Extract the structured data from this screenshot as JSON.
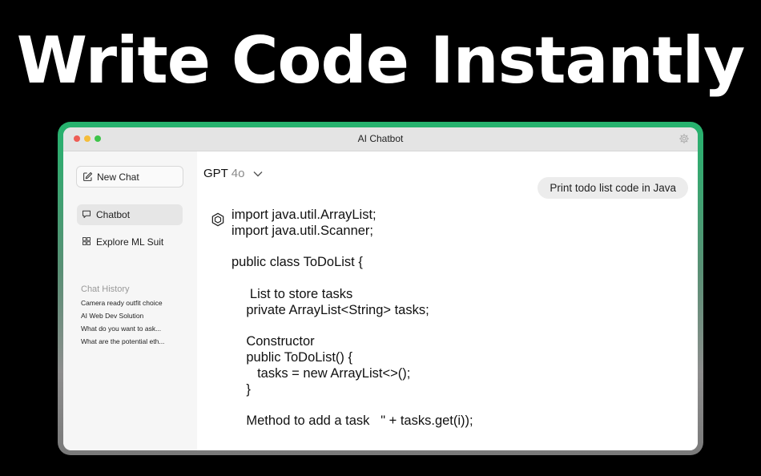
{
  "headline": "Write Code Instantly",
  "window": {
    "title": "AI Chatbot",
    "settings_icon": "gear-icon"
  },
  "sidebar": {
    "new_chat": {
      "label": "New Chat",
      "icon": "edit-icon"
    },
    "items": [
      {
        "label": "Chatbot",
        "icon": "chat-bubble-icon",
        "active": true
      },
      {
        "label": "Explore ML Suit",
        "icon": "grid-icon",
        "active": false
      }
    ],
    "history": {
      "title": "Chat History",
      "items": [
        "Camera ready outfit choice",
        "AI Web Dev Solution",
        "What do you want to ask...",
        "What are the potential eth..."
      ]
    }
  },
  "main": {
    "model": {
      "name": "GPT",
      "version": "4o"
    },
    "user_message": "Print todo list code in Java",
    "code_lines": [
      "import java.util.ArrayList;",
      "import java.util.Scanner;",
      "",
      "public class ToDoList {",
      "",
      "     List to store tasks",
      "    private ArrayList<String> tasks;",
      "",
      "    Constructor",
      "    public ToDoList() {",
      "       tasks = new ArrayList<>();",
      "    }",
      "",
      "    Method to add a task   \" + tasks.get(i));"
    ]
  },
  "colors": {
    "background": "#000000",
    "frame_accent": "#25b36e",
    "titlebar": "#e4e4e4",
    "sidebar": "#f6f6f6"
  }
}
